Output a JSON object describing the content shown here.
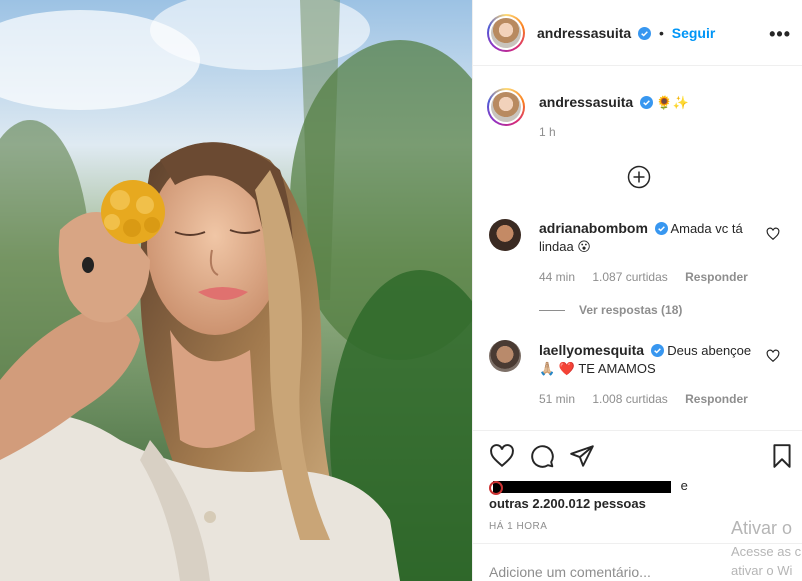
{
  "post_author": {
    "username": "andressasuita",
    "follow_label": "Seguir",
    "separator": "•"
  },
  "caption": {
    "username": "andressasuita",
    "text": "🌻✨",
    "time_ago": "1 h"
  },
  "comments": [
    {
      "username": "adrianabombom",
      "text": "Amada vc tá lindaa 😮",
      "time_ago": "44 min",
      "likes": "1.087 curtidas",
      "reply_label": "Responder"
    },
    {
      "username": "laellyomesquita",
      "text": "Deus abençoe 🙏🏼 ❤️ TE AMAMOS",
      "time_ago": "51 min",
      "likes": "1.008 curtidas",
      "reply_label": "Responder"
    }
  ],
  "view_replies_label": "Ver respostas (18)",
  "likes_summary": {
    "conjunction": "e",
    "others": "outras 2.200.012 pessoas"
  },
  "posted_time": "HÁ 1 HORA",
  "add_comment_placeholder": "Adicione um comentário...",
  "activation_watermark": {
    "title": "Ativar o",
    "line1": "Acesse as c",
    "line2": "ativar o Wi"
  },
  "colors": {
    "link_blue": "#0095f6",
    "verified_blue": "#3897f0",
    "muted_text": "#8e8e8e",
    "border": "#efefef"
  }
}
